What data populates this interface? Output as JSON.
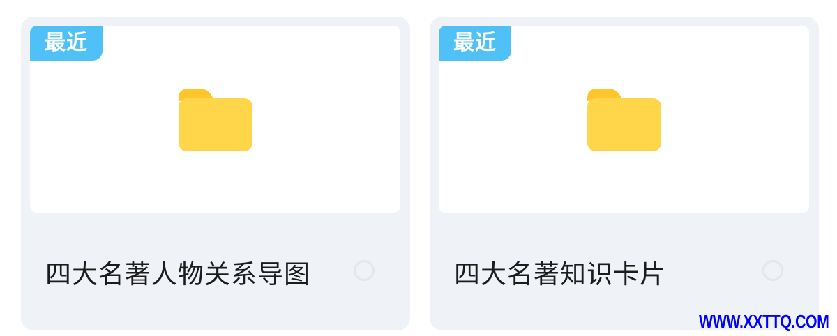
{
  "files": [
    {
      "badge": "最近",
      "name": "四大名著人物关系导图",
      "icon": "folder-icon"
    },
    {
      "badge": "最近",
      "name": "四大名著知识卡片",
      "icon": "folder-icon"
    }
  ],
  "colors": {
    "card_bg": "#eff3f8",
    "badge_bg": "#4fc1f7",
    "folder_main": "#ffd54a",
    "folder_tab": "#ffc62b",
    "watermark": "#0000ff"
  },
  "watermark": "WWW.XXTTQ.COM"
}
